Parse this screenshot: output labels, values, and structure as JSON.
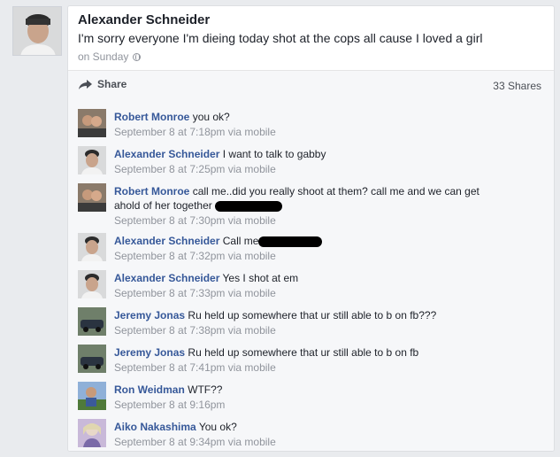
{
  "post": {
    "author": "Alexander Schneider",
    "status": "I'm sorry everyone I'm dieing today shot at the cops all cause I loved a girl",
    "time": "on Sunday"
  },
  "actions": {
    "share_label": "Share",
    "shares_count": "33 Shares"
  },
  "comments": [
    {
      "name": "Robert Monroe",
      "text": "you ok?",
      "meta": "September 8 at 7:18pm via mobile"
    },
    {
      "name": "Alexander Schneider",
      "text": "I want to talk to gabby",
      "meta": "September 8 at 7:25pm via mobile"
    },
    {
      "name": "Robert Monroe",
      "text": "call me..did you really shoot at them? call me and we can get ahold of her together",
      "meta": "September 8 at 7:30pm via mobile"
    },
    {
      "name": "Alexander Schneider",
      "text": "Call me",
      "meta": "September 8 at 7:32pm via mobile"
    },
    {
      "name": "Alexander Schneider",
      "text": "Yes I shot at em",
      "meta": "September 8 at 7:33pm via mobile"
    },
    {
      "name": "Jeremy Jonas",
      "text": "Ru held up somewhere that ur still able to b on fb???",
      "meta": "September 8 at 7:38pm via mobile"
    },
    {
      "name": "Jeremy Jonas",
      "text": "Ru held up somewhere that ur still able to b on fb",
      "meta": "September 8 at 7:41pm via mobile"
    },
    {
      "name": "Ron Weidman",
      "text": "WTF??",
      "meta": "September 8 at 9:16pm"
    },
    {
      "name": "Aiko Nakashima",
      "text": "You ok?",
      "meta": "September 8 at 9:34pm via mobile"
    }
  ],
  "colors": {
    "link": "#365899",
    "text": "#1d2129",
    "meta": "#90949c",
    "bg": "#e9ebee"
  }
}
